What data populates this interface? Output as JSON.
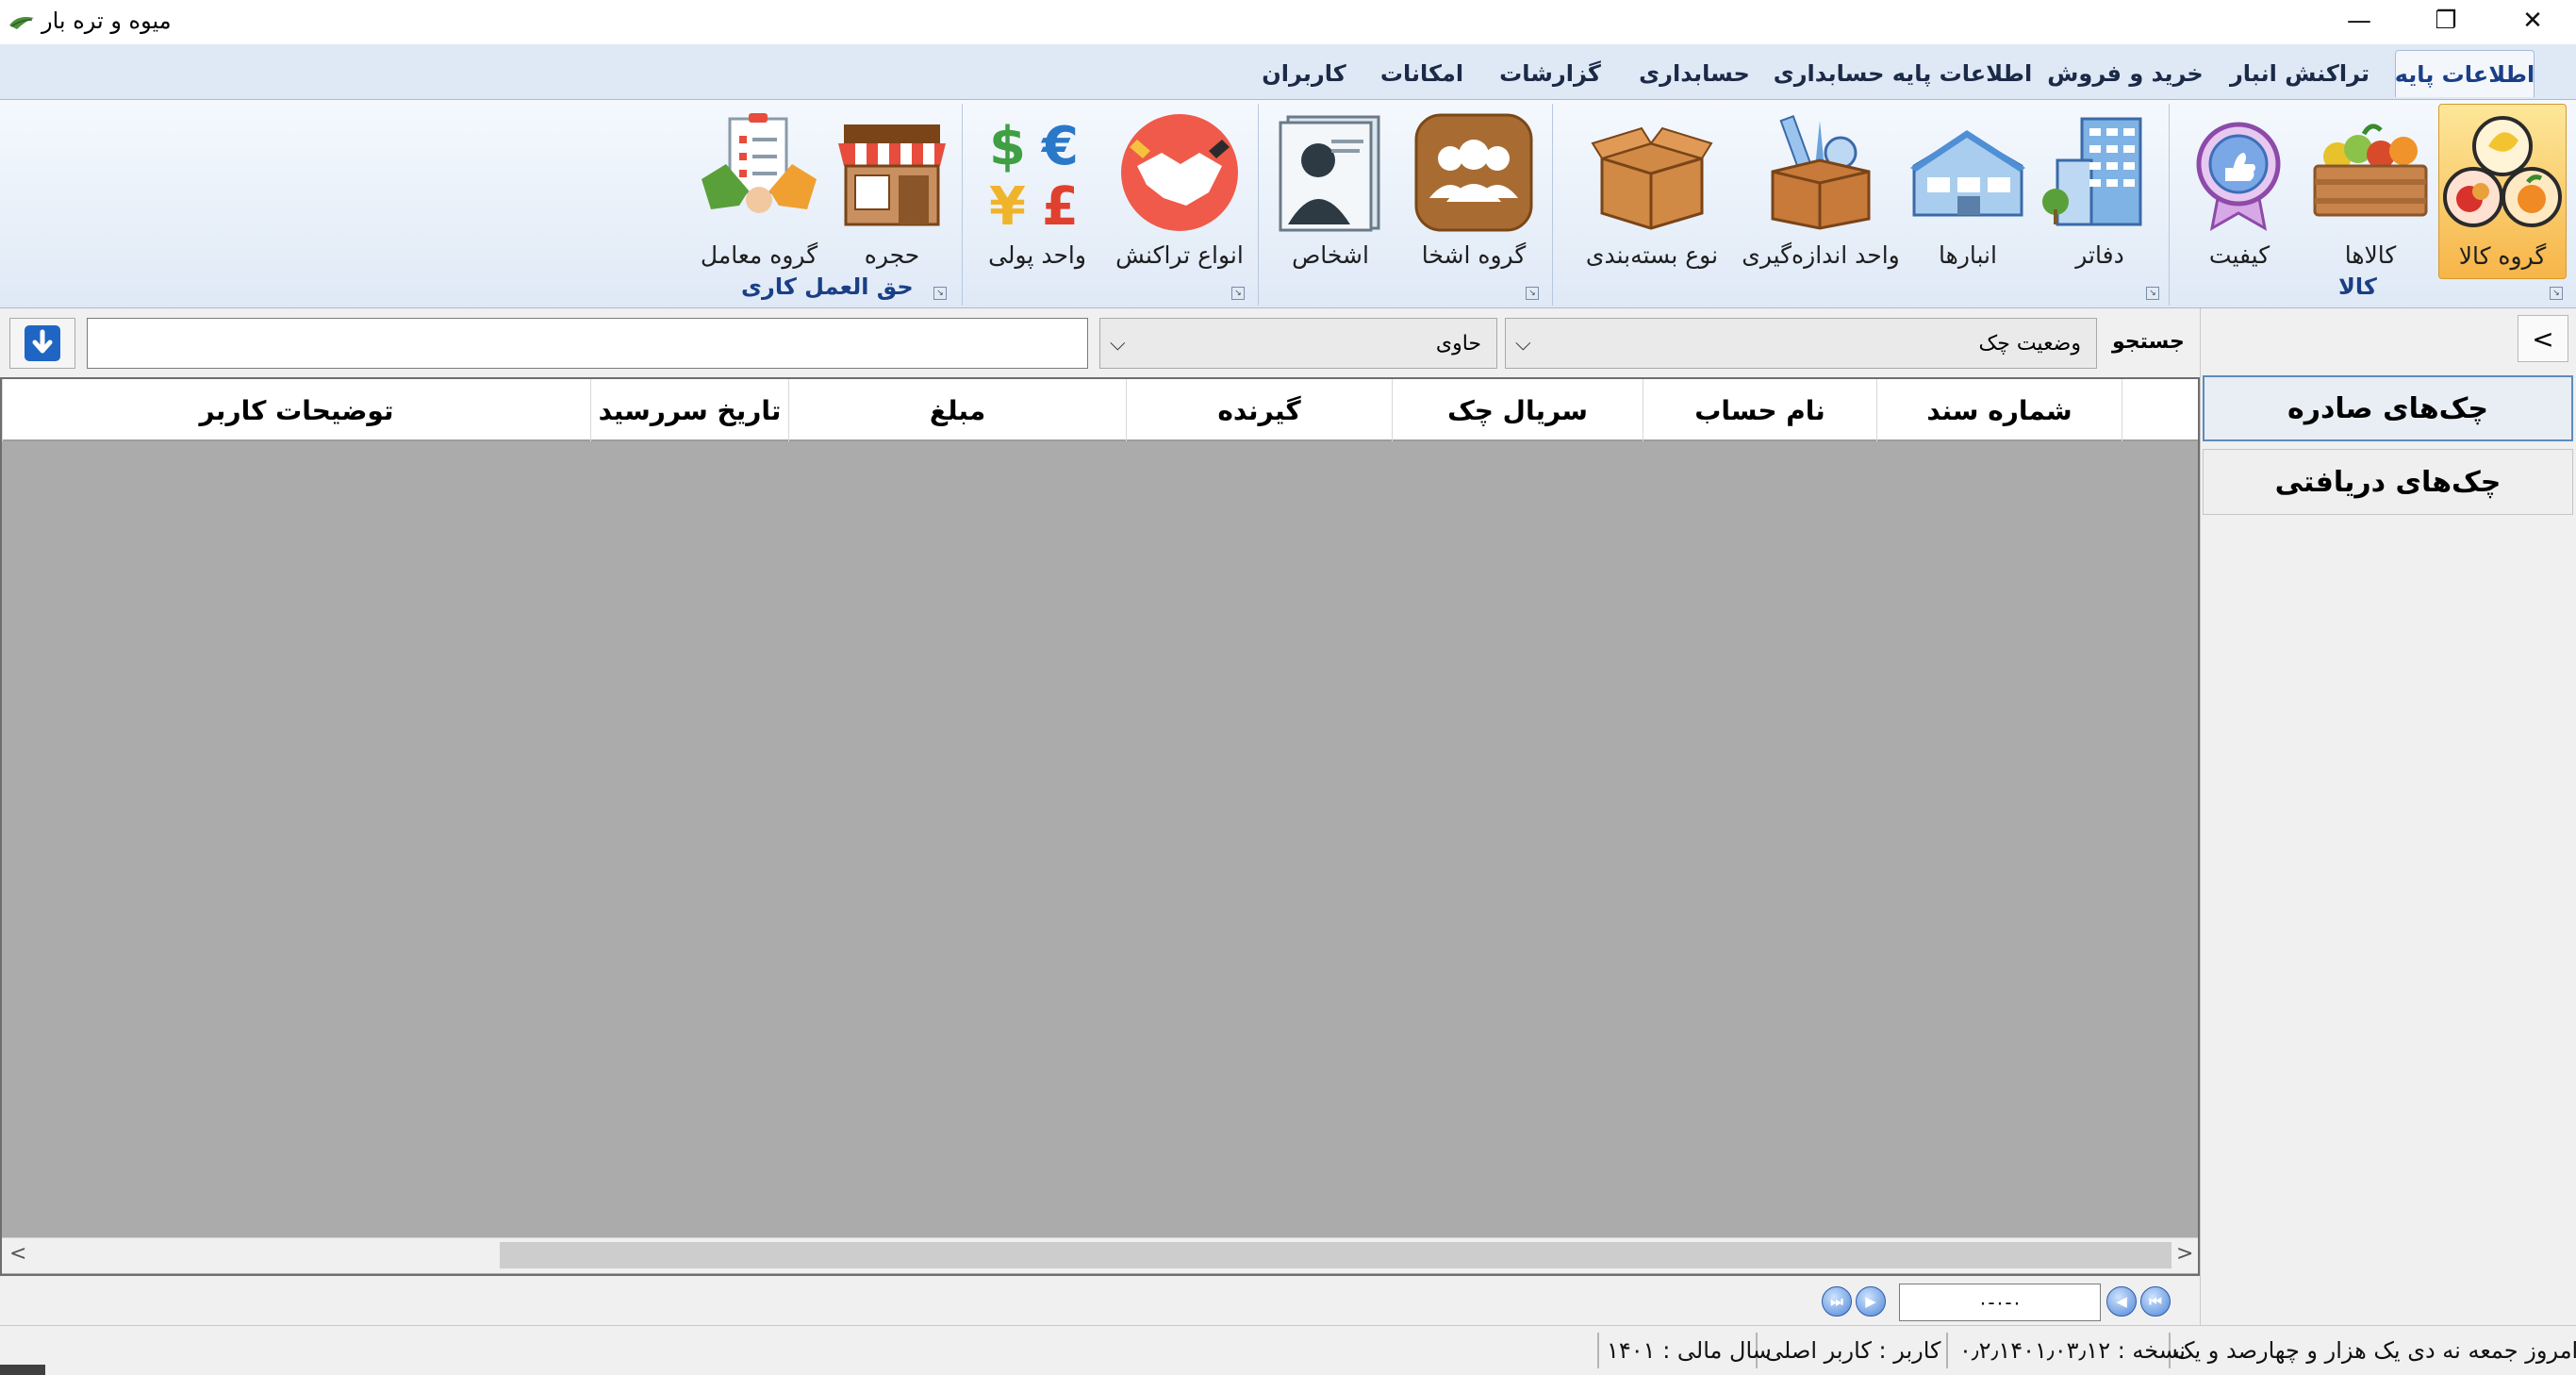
{
  "window": {
    "title": "میوه و تره بار",
    "minimize": "—",
    "maximize": "❐",
    "close": "✕"
  },
  "tabs": [
    {
      "label": "اطلاعات پایه",
      "active": true
    },
    {
      "label": "تراکنش انبار"
    },
    {
      "label": "خرید و فروش"
    },
    {
      "label": "اطلاعات پایه حسابداری"
    },
    {
      "label": "حسابداری"
    },
    {
      "label": "گزارشات"
    },
    {
      "label": "امکانات"
    },
    {
      "label": "کاربران"
    }
  ],
  "ribbon": {
    "buttons": [
      {
        "label": "گروه کالا",
        "icon": "fruit-group-icon",
        "selected": true
      },
      {
        "label": "کالاها",
        "icon": "fruit-crate-icon"
      },
      {
        "label": "کیفیت",
        "icon": "quality-badge-icon"
      },
      {
        "label": "دفاتر",
        "icon": "office-building-icon"
      },
      {
        "label": "انبارها",
        "icon": "warehouse-icon"
      },
      {
        "label": "واحد اندازه‌گیری",
        "icon": "measure-box-icon"
      },
      {
        "label": "نوع بسته‌بندی",
        "icon": "package-box-icon"
      },
      {
        "label": "گروه اشخا",
        "icon": "people-group-icon"
      },
      {
        "label": "اشخاص",
        "icon": "person-card-icon"
      },
      {
        "label": "انواع تراکنش",
        "icon": "handshake-icon"
      },
      {
        "label": "واحد پولی",
        "icon": "currency-icon"
      },
      {
        "label": "حجره",
        "icon": "shop-icon"
      },
      {
        "label": "گروه معامل",
        "icon": "deal-icon"
      }
    ],
    "groups": [
      {
        "label": "کالا"
      },
      {
        "label": ""
      },
      {
        "label": ""
      },
      {
        "label": ""
      },
      {
        "label": "حق العمل کاری"
      }
    ]
  },
  "filter": {
    "search_label": "جستجو",
    "field_value": "وضعیت چک",
    "operator_value": "حاوی",
    "search_text": ""
  },
  "side": {
    "collapse_label": "<",
    "items": [
      {
        "label": "چک‌های صادره",
        "active": true
      },
      {
        "label": "چک‌های دریافتی"
      }
    ]
  },
  "grid": {
    "columns": [
      "شماره سند",
      "نام حساب",
      "سریال چک",
      "گیرنده",
      "مبلغ",
      "تاریخ سررسید",
      "توضیحات کاربر"
    ]
  },
  "pager": {
    "first": "⏮",
    "prev": "◀",
    "next": "▶",
    "last": "⏭",
    "value": "۰-۰-۰"
  },
  "status": {
    "date": "امروز جمعه نه  دی یک هزار و چهارصد و یک",
    "version": "نسخه : ۰٫۲٫۱۴۰۱٫۰۳٫۱۲",
    "user": "کاربر : کاربر اصلی",
    "fiscal_year": "سال مالی : ۱۴۰۱"
  },
  "colors": {
    "accent": "#1a3f86",
    "ribbon": "#dfe9f6",
    "selected": "#f7b548",
    "grid_bg": "#ababab"
  }
}
